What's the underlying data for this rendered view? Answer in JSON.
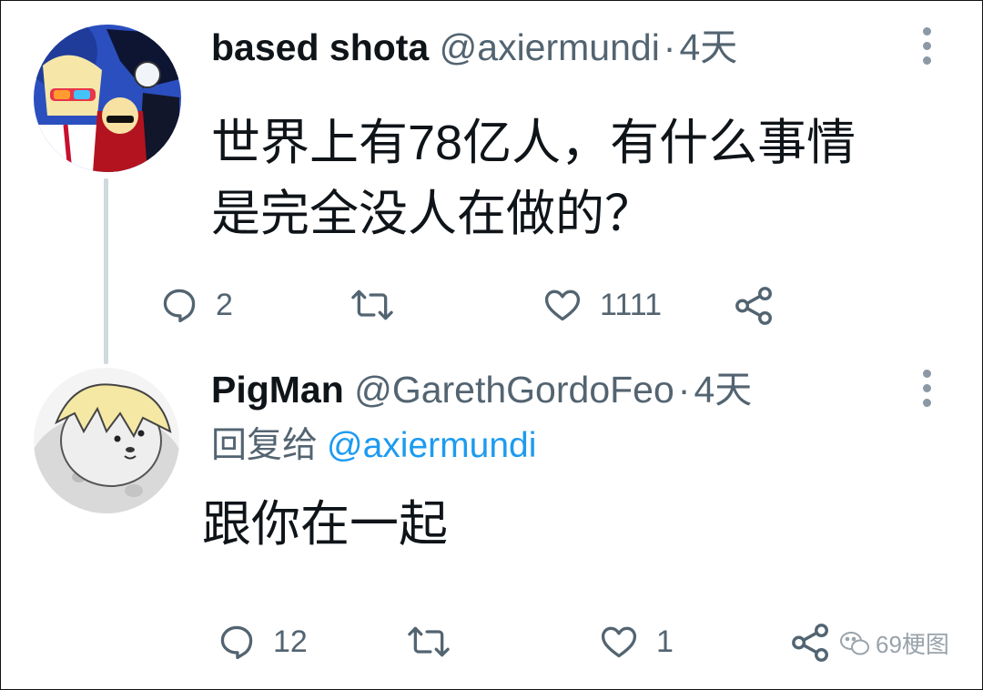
{
  "tweets": [
    {
      "display_name": "based shota",
      "handle": "@axiermundi",
      "separator": "·",
      "time": "4天",
      "text_lines": [
        "世界上有78亿人，有什么事情",
        "是完全没人在做的？"
      ],
      "actions": {
        "reply_count": "2",
        "retweet_count": "",
        "like_count": "1111"
      }
    },
    {
      "display_name": "PigMan",
      "handle": "@GarethGordoFeo",
      "separator": "·",
      "time": "4天",
      "reply_label": "回复给",
      "reply_mention": "@axiermundi",
      "text_lines": [
        "跟你在一起"
      ],
      "actions": {
        "reply_count": "12",
        "retweet_count": "",
        "like_count": "1"
      }
    }
  ],
  "watermark": {
    "text": "69梗图"
  },
  "colors": {
    "text_primary": "#0f1419",
    "text_secondary": "#536471",
    "mention_blue": "#1d9bf0",
    "thread_line": "#cfd9de"
  },
  "icons": [
    "more-vertical-icon",
    "reply-icon",
    "retweet-icon",
    "like-icon",
    "share-icon",
    "wechat-icon"
  ]
}
